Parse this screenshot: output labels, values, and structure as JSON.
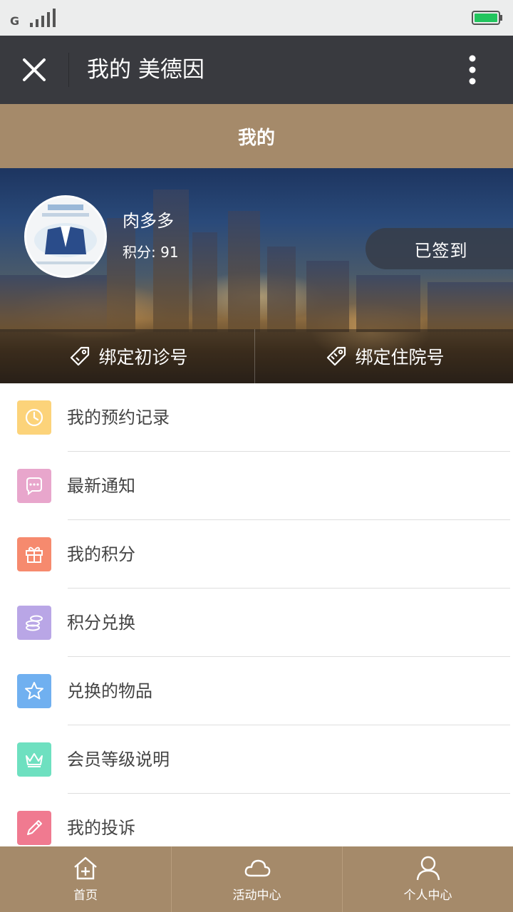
{
  "status_bar": {
    "carrier": "G",
    "signal_icon": "signal-bars-icon",
    "battery_icon": "battery-icon",
    "battery_color": "#22c55e"
  },
  "title_bar": {
    "title": "我的 美德因",
    "close_icon": "close-icon",
    "more_icon": "more-vertical-icon"
  },
  "header": {
    "title": "我的",
    "background": "#a58a6a"
  },
  "profile": {
    "username": "肉多多",
    "points_text": "积分: 91",
    "signin_label": "已签到",
    "bind_first_visit_label": "绑定初诊号",
    "bind_inpatient_label": "绑定住院号"
  },
  "menu": {
    "items": [
      {
        "label": "我的预约记录",
        "icon": "clock-icon",
        "color": "#fcd37a"
      },
      {
        "label": "最新通知",
        "icon": "chat-bubble-icon",
        "color": "#e8a6cc"
      },
      {
        "label": "我的积分",
        "icon": "gift-icon",
        "color": "#f68a6e"
      },
      {
        "label": "积分兑换",
        "icon": "coins-icon",
        "color": "#b9a6e6"
      },
      {
        "label": "兑换的物品",
        "icon": "star-icon",
        "color": "#70b0f0"
      },
      {
        "label": "会员等级说明",
        "icon": "crown-icon",
        "color": "#6ee0c0"
      },
      {
        "label": "我的投诉",
        "icon": "pencil-icon",
        "color": "#f07a90"
      }
    ]
  },
  "bottom_nav": {
    "items": [
      {
        "label": "首页",
        "icon": "home-icon"
      },
      {
        "label": "活动中心",
        "icon": "cloud-icon"
      },
      {
        "label": "个人中心",
        "icon": "user-icon"
      }
    ]
  }
}
